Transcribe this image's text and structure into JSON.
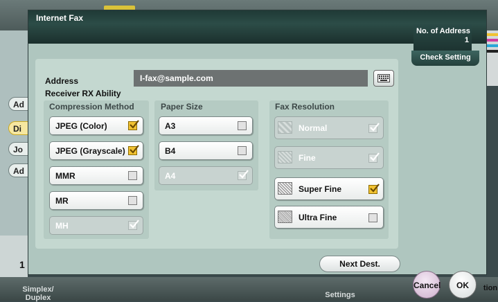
{
  "dialog": {
    "title": "Internet Fax",
    "no_of_address_label": "No. of Address",
    "no_of_address_value": "1",
    "check_setting_label": "Check Setting",
    "address_label": "Address",
    "address_value": "I-fax@sample.com",
    "receiver_rx_label": "Receiver RX Ability",
    "next_dest_label": "Next Dest."
  },
  "compression": {
    "label": "Compression Method",
    "options": [
      {
        "label": "JPEG (Color)",
        "checked": true,
        "enabled": true
      },
      {
        "label": "JPEG (Grayscale)",
        "checked": true,
        "enabled": true
      },
      {
        "label": "MMR",
        "checked": false,
        "enabled": true
      },
      {
        "label": "MR",
        "checked": false,
        "enabled": true
      },
      {
        "label": "MH",
        "checked": true,
        "enabled": false
      }
    ]
  },
  "paper_size": {
    "label": "Paper Size",
    "options": [
      {
        "label": "A3",
        "checked": false,
        "enabled": true
      },
      {
        "label": "B4",
        "checked": false,
        "enabled": true
      },
      {
        "label": "A4",
        "checked": true,
        "enabled": false
      }
    ]
  },
  "fax_resolution": {
    "label": "Fax Resolution",
    "options": [
      {
        "label": "Normal",
        "checked": true,
        "enabled": false
      },
      {
        "label": "Fine",
        "checked": true,
        "enabled": false
      },
      {
        "label": "Super Fine",
        "checked": true,
        "enabled": true
      },
      {
        "label": "Ultra Fine",
        "checked": false,
        "enabled": true
      }
    ]
  },
  "footer": {
    "cancel_label": "Cancel",
    "ok_label": "OK"
  },
  "background": {
    "side_items": [
      "Ad",
      "Di",
      "Jo",
      "Ad"
    ],
    "counter": "1",
    "bottom_labels": [
      "Simplex/\nDuplex",
      "Settings"
    ],
    "right_partial": "tion"
  },
  "colors": {
    "checked": "#f1c232",
    "dialog_bg": "#afc6bf",
    "titlebar": "#1f3a36"
  }
}
